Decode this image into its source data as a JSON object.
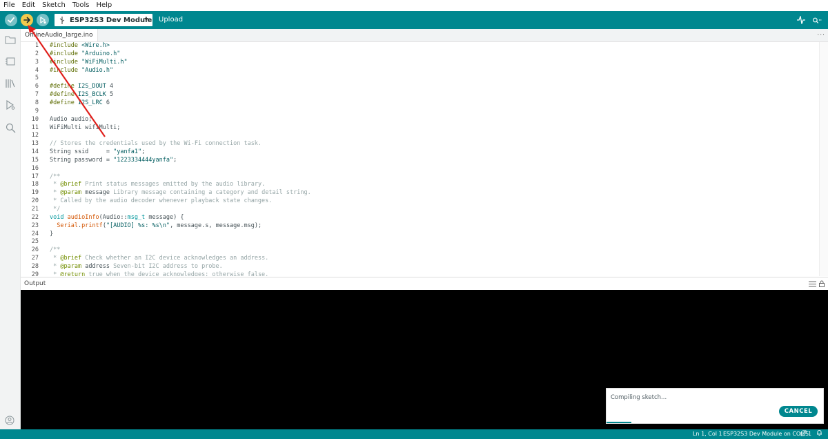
{
  "menu": [
    "File",
    "Edit",
    "Sketch",
    "Tools",
    "Help"
  ],
  "toolbar": {
    "board": "ESP32S3 Dev Module",
    "upload_label": "Upload",
    "verify_icon": "check-icon",
    "upload_icon": "arrow-right-icon",
    "debug_icon": "debug-icon",
    "colors": {
      "bar": "#00878f",
      "upload_button": "#f2c94c",
      "button": "#78c1c6"
    }
  },
  "tab": {
    "label": "OnlineAudio_large.ino",
    "more": "···"
  },
  "editor": {
    "lines": [
      {
        "n": "1",
        "html": "<span class='k-pre'>#include</span> <span class='k-str'>&lt;Wire.h&gt;</span>"
      },
      {
        "n": "2",
        "html": "<span class='k-pre'>#include</span> <span class='k-str'>\"Arduino.h\"</span>"
      },
      {
        "n": "3",
        "html": "<span class='k-pre'>#include</span> <span class='k-str'>\"WiFiMulti.h\"</span>"
      },
      {
        "n": "4",
        "html": "<span class='k-pre'>#include</span> <span class='k-str'>\"Audio.h\"</span>"
      },
      {
        "n": "5",
        "html": ""
      },
      {
        "n": "6",
        "html": "<span class='k-pre'>#define</span> <span class='k-str'>I2S_DOUT</span> 4"
      },
      {
        "n": "7",
        "html": "<span class='k-pre'>#define</span> <span class='k-str'>I2S_BCLK</span> 5"
      },
      {
        "n": "8",
        "html": "<span class='k-pre'>#define</span> <span class='k-str'>I2S_LRC</span> 6"
      },
      {
        "n": "9",
        "html": ""
      },
      {
        "n": "10",
        "html": "Audio audio;"
      },
      {
        "n": "11",
        "html": "WiFiMulti wifiMulti;"
      },
      {
        "n": "12",
        "html": ""
      },
      {
        "n": "13",
        "html": "<span class='k-com'>// Stores the credentials used by the Wi-Fi connection task.</span>"
      },
      {
        "n": "14",
        "html": "String ssid     = <span class='k-str'>\"yanfa1\"</span>;"
      },
      {
        "n": "15",
        "html": "String password = <span class='k-str'>\"1223334444yanfa\"</span>;"
      },
      {
        "n": "16",
        "html": ""
      },
      {
        "n": "17",
        "html": "<span class='k-com'>/**</span>"
      },
      {
        "n": "18",
        "html": "<span class='k-com'> * </span><span class='k-tag'>@brief</span><span class='k-com'> Print status messages emitted by the audio library.</span>"
      },
      {
        "n": "19",
        "html": "<span class='k-com'> * </span><span class='k-tag'>@param</span> message <span class='k-com'>Library message containing a category and detail string.</span>"
      },
      {
        "n": "20",
        "html": "<span class='k-com'> * Called by the audio decoder whenever playback state changes.</span>"
      },
      {
        "n": "21",
        "html": "<span class='k-com'> */</span>"
      },
      {
        "n": "22",
        "html": "<span class='k-type'>void</span> <span class='k-fn'>audioInfo</span>(Audio::<span class='k-type'>msg_t</span> message) {"
      },
      {
        "n": "23",
        "html": "  <span class='k-fn'>Serial</span>.<span class='k-fn'>printf</span>(<span class='k-str'>\"[AUDIO] %s: %s\\n\"</span>, message.s, message.msg);"
      },
      {
        "n": "24",
        "html": "}"
      },
      {
        "n": "25",
        "html": ""
      },
      {
        "n": "26",
        "html": "<span class='k-com'>/**</span>"
      },
      {
        "n": "27",
        "html": "<span class='k-com'> * </span><span class='k-tag'>@brief</span><span class='k-com'> Check whether an I2C device acknowledges an address.</span>"
      },
      {
        "n": "28",
        "html": "<span class='k-com'> * </span><span class='k-tag'>@param</span> address <span class='k-com'>Seven-bit I2C address to probe.</span>"
      },
      {
        "n": "29",
        "html": "<span class='k-com'> * </span><span class='k-tag'>@return</span><span class='k-com'> true when the device acknowledges; otherwise false.</span>"
      }
    ]
  },
  "output": {
    "title": "Output"
  },
  "notification": {
    "message": "Compiling sketch...",
    "cancel": "CANCEL"
  },
  "status": {
    "position": "Ln 1, Col 1",
    "board_port": "ESP32S3 Dev Module on COM5",
    "count": "1"
  }
}
